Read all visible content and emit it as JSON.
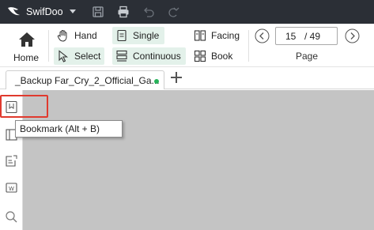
{
  "app": {
    "name": "SwifDoo",
    "accent_color": "#27b35a",
    "titlebar_color": "#2b2f36"
  },
  "titlebar": {
    "icons": [
      "save-icon",
      "print-icon",
      "undo-icon",
      "redo-icon"
    ]
  },
  "ribbon": {
    "home_label": "Home",
    "hand_label": "Hand",
    "select_label": "Select",
    "single_label": "Single",
    "continuous_label": "Continuous",
    "facing_label": "Facing",
    "book_label": "Book",
    "page": {
      "current": "15",
      "total": "/ 49",
      "label": "Page"
    }
  },
  "tabs": [
    {
      "label": "_Backup Far_Cry_2_Official_Ga...",
      "modified": true
    }
  ],
  "sidebar": {
    "items": [
      "bookmark-icon",
      "thumbnail-icon",
      "annotation-icon",
      "word-icon",
      "search-icon"
    ]
  },
  "tooltip": {
    "text": "Bookmark  (Alt + B)"
  }
}
